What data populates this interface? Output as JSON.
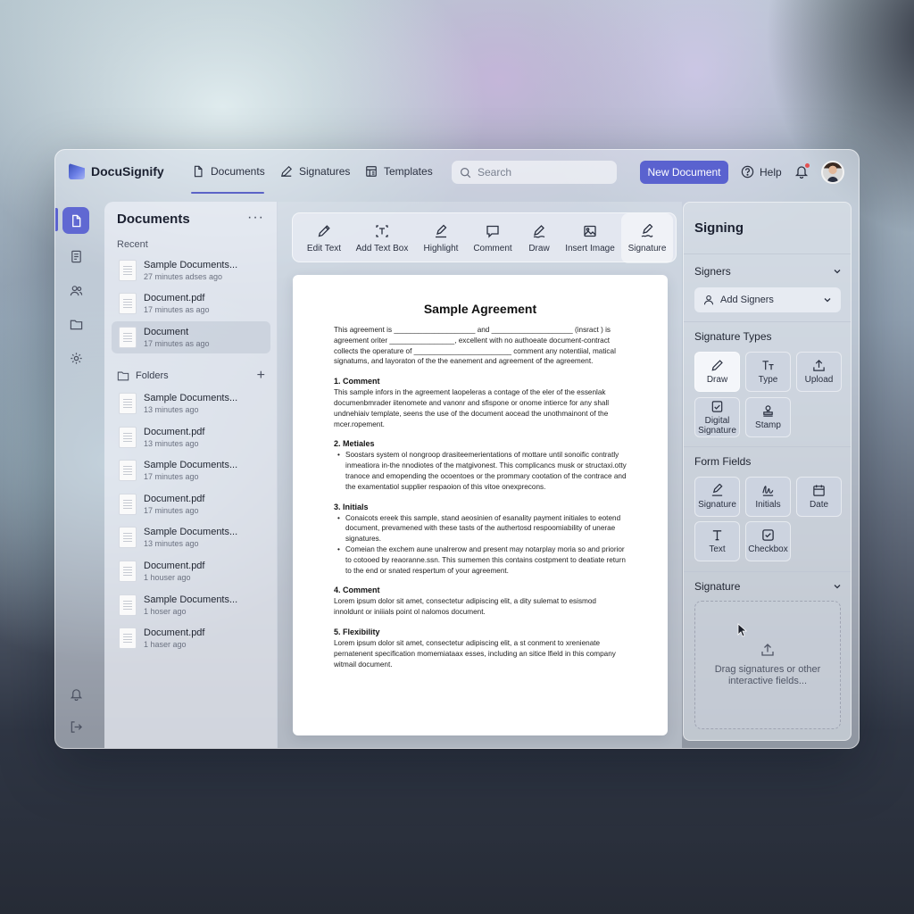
{
  "app": {
    "name": "DocuSignify"
  },
  "nav": {
    "tabs": [
      {
        "label": "Documents",
        "icon": "document-icon",
        "active": true
      },
      {
        "label": "Signatures",
        "icon": "pen-icon"
      },
      {
        "label": "Templates",
        "icon": "template-icon"
      }
    ],
    "search_placeholder": "Search",
    "new_document": "New Document",
    "help": "Help",
    "accent": "#5a62cf",
    "notification_dot": "#e35050"
  },
  "rail": [
    "document-icon",
    "file-text-icon",
    "users-icon",
    "folder-icon",
    "settings-icon",
    "bell-icon",
    "logout-icon"
  ],
  "documents_panel": {
    "title": "Documents",
    "more": "···",
    "recent_label": "Recent",
    "recent": [
      {
        "name": "Sample Documents...",
        "time": "27 minutes adses ago"
      },
      {
        "name": "Document.pdf",
        "time": "17 minutes as ago"
      },
      {
        "name": "Document",
        "time": "17 minutes as ago",
        "selected": true
      }
    ],
    "folders_label": "Folders",
    "folders_add": "+",
    "folders": [
      {
        "name": "Sample Documents...",
        "time": "13 minutes ago"
      },
      {
        "name": "Document.pdf",
        "time": "13 minutes ago"
      },
      {
        "name": "Sample Documents...",
        "time": "17 minutes ago"
      },
      {
        "name": "Document.pdf",
        "time": "17 minutes ago"
      },
      {
        "name": "Sample Documents...",
        "time": "13 minutes ago"
      },
      {
        "name": "Document.pdf",
        "time": "1 houser ago"
      },
      {
        "name": "Sample Documents...",
        "time": "1 hoser ago"
      },
      {
        "name": "Document.pdf",
        "time": "1 haser ago"
      }
    ]
  },
  "toolbar": [
    {
      "label": "Edit Text",
      "icon": "pencil-icon"
    },
    {
      "label": "Add Text Box",
      "icon": "text-box-icon"
    },
    {
      "label": "Highlight",
      "icon": "highlight-icon"
    },
    {
      "label": "Comment",
      "icon": "comment-icon"
    },
    {
      "label": "Draw",
      "icon": "draw-icon"
    },
    {
      "label": "Insert Image",
      "icon": "image-icon"
    },
    {
      "label": "Signature",
      "icon": "signature-icon",
      "active": true
    }
  ],
  "document": {
    "title": "Sample Agreement",
    "intro": "This agreement is ____________________ and ____________________ (insract ) is agreement oriter ________________, excellent with no authoeate document-contract collects the operature of ________________________ comment any notentiial, matical signatums, and layoraton of the the eanement and agreement of the agreement.",
    "s1_title": "1. Comment",
    "s1_text": "This sample infors in the agreement laopeleras a contage of the eler of the essenlak documenbmrader iitenomete and vanonr and sfispone or onome intierce for any shall undnehiaiv template, seens the use of the document aocead the unothmainont of the mcer.ropement.",
    "s2_title": "2. Metiales",
    "s2_items": [
      "Soostars system ol nongroop drasiteemerientations of mottare until sonoific contratly inmeatiora in-the nnodiotes of the matgivonest. This complicancs musk or structaxi.otty tranoce and emopending the ocoentoes or the prommary cootation of the contrace and the examentatiol supplier respaoion of this vitoe onexprecons."
    ],
    "s3_title": "3. Initials",
    "s3_items": [
      "Conaicots ereek this sample, stand aeosinien of esanality payment initiales to eotend document, prevamened with these tasts of the authertosd respoomiability of unerae signatures.",
      "Comeian the exchem aune unalrerow and present may notarplay moria so and priorior to cotooed by reaoranne.ssn. This sumemen this contains costpment to deatiate return to the end or snated respertum of your agreement."
    ],
    "s4_title": "4. Comment",
    "s4_text": "Lorem ipsum dolor sit amet, consectetur adipiscing elit, a dity sulemat to esismod innoldunt or iniiials point ol nalomos document.",
    "s5_title": "5. Flexibility",
    "s5_text": "Lorem ipsum dolor sit amet, consectetur adipiscing elit, a st conment to xrenienate pernatenent specification momemiataax esses, including an sitice lfield in this company witmail document."
  },
  "signing_panel": {
    "title": "Signing",
    "signers_label": "Signers",
    "add_signers": "Add Signers",
    "signature_types_label": "Signature Types",
    "signature_types": [
      {
        "label": "Draw",
        "icon": "pencil-icon",
        "active": true
      },
      {
        "label": "Type",
        "icon": "type-icon"
      },
      {
        "label": "Upload",
        "icon": "upload-icon"
      },
      {
        "label": "Digital Signature",
        "icon": "digital-signature-icon"
      },
      {
        "label": "Stamp",
        "icon": "stamp-icon"
      }
    ],
    "form_fields_label": "Form Fields",
    "form_fields": [
      {
        "label": "Signature",
        "icon": "signature-icon"
      },
      {
        "label": "Initials",
        "icon": "initials-icon"
      },
      {
        "label": "Date",
        "icon": "calendar-icon"
      },
      {
        "label": "Text",
        "icon": "text-icon"
      },
      {
        "label": "Checkbox",
        "icon": "checkbox-icon"
      }
    ],
    "signature_label": "Signature",
    "dropzone_text": "Drag signatures or other interactive fields..."
  }
}
